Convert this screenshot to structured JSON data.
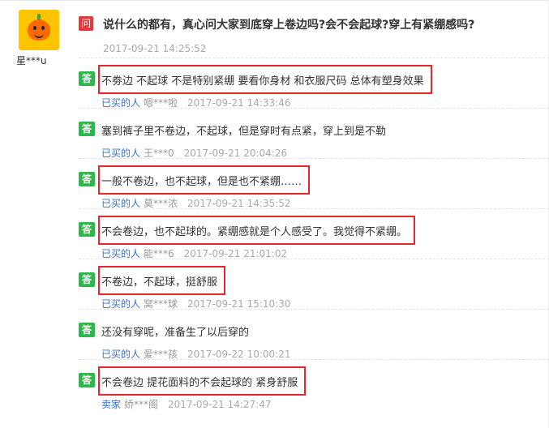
{
  "asker": {
    "avatar_icon": "orange-mascot-avatar-icon",
    "name": "星***u"
  },
  "question": {
    "badge": "问",
    "text": "说什么的都有，真心问大家到底穿上卷边吗?会不会起球?穿上有紧绷感吗?",
    "time": "2017-09-21 14:25:52"
  },
  "answers": [
    {
      "badge": "答",
      "text": "不劵边 不起球 不是特别紧绷 要看你身材 和衣服尺码 总体有塑身效果",
      "role": "已买的人",
      "user": "嗯***啦",
      "time": "2017-09-21 14:33:46",
      "highlighted": true
    },
    {
      "badge": "答",
      "text": "塞到裤子里不卷边，不起球，但是穿时有点紧，穿上到是不勒",
      "role": "已买的人",
      "user": "王***0",
      "time": "2017-09-21 20:04:26",
      "highlighted": false
    },
    {
      "badge": "答",
      "text": "一般不卷边，也不起球，但是也不紧绷……",
      "role": "已买的人",
      "user": "莫***浓",
      "time": "2017-09-21 14:35:52",
      "highlighted": true
    },
    {
      "badge": "答",
      "text": "不会卷边，也不起球的。紧绷感就是个人感受了。我觉得不紧绷。",
      "role": "已买的人",
      "user": "能***6",
      "time": "2017-09-21 21:01:02",
      "highlighted": true
    },
    {
      "badge": "答",
      "text": "不卷边，不起球，挺舒服",
      "role": "已买的人",
      "user": "窝***球",
      "time": "2017-09-21 15:10:30",
      "highlighted": true
    },
    {
      "badge": "答",
      "text": "还没有穿呢，准备生了以后穿的",
      "role": "已买的人",
      "user": "爱***孩",
      "time": "2017-09-22 10:00:21",
      "highlighted": false
    },
    {
      "badge": "答",
      "text": "不会卷边 提花面料的不会起球的 紧身舒服",
      "role": "卖家",
      "user": "娇***阁",
      "time": "2017-09-21 14:27:47",
      "highlighted": true
    }
  ],
  "colors": {
    "question_badge": "#e4393c",
    "answer_badge": "#2eb84b",
    "highlight_box": "#e8262b",
    "role_link": "#3a6fc9"
  }
}
